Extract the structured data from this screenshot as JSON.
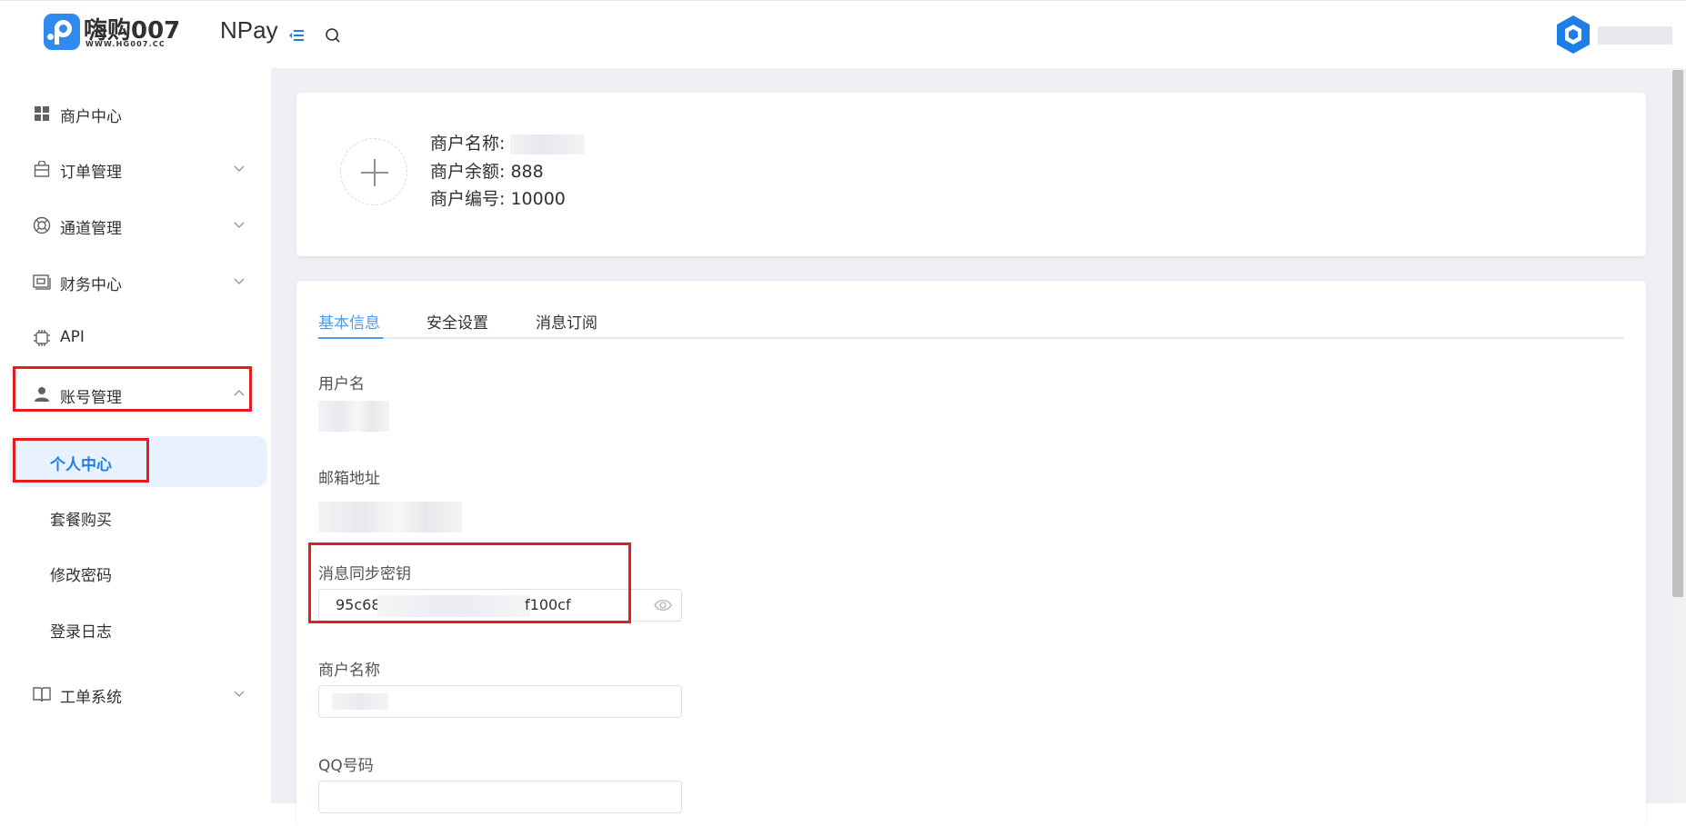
{
  "header": {
    "logo_cn": "嗨购007",
    "logo_url": "WWW.HG007.CC",
    "logo_product": "NPay",
    "user_name": ""
  },
  "sidebar": {
    "items": [
      {
        "label": "商户中心",
        "icon": "grid-icon"
      },
      {
        "label": "订单管理",
        "icon": "shopping-bag-icon"
      },
      {
        "label": "通道管理",
        "icon": "lifebuoy-icon"
      },
      {
        "label": "财务中心",
        "icon": "wallet-icon"
      },
      {
        "label": "API",
        "icon": "chip-icon"
      },
      {
        "label": "账号管理",
        "icon": "user-icon"
      },
      {
        "label": "工单系统",
        "icon": "book-icon"
      }
    ],
    "account_sub": [
      {
        "label": "个人中心",
        "active": true
      },
      {
        "label": "套餐购买"
      },
      {
        "label": "修改密码"
      },
      {
        "label": "登录日志"
      }
    ]
  },
  "profile": {
    "name_label": "商户名称:",
    "balance_label": "商户余额:",
    "balance_value": "888",
    "id_label": "商户编号:",
    "id_value": "10000"
  },
  "tabs": [
    "基本信息",
    "安全设置",
    "消息订阅"
  ],
  "form": {
    "username_label": "用户名",
    "email_label": "邮箱地址",
    "secret_label": "消息同步密钥",
    "secret_prefix": "95c68",
    "secret_suffix": "f100cf",
    "merchant_name_label": "商户名称",
    "qq_label": "QQ号码"
  },
  "colors": {
    "accent": "#4a9cf0",
    "active_menu_bg": "#e8f2fe",
    "highlight_box": "#e41d1d",
    "brand": "#2f8bf0"
  }
}
